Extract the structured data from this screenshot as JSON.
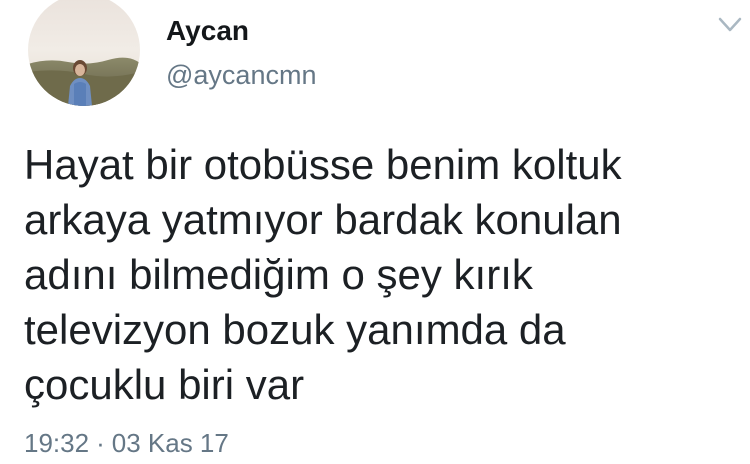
{
  "tweet": {
    "author": {
      "display_name": "Aycan",
      "handle": "@aycancmn"
    },
    "text_lines": [
      "Hayat bir otobüsse benim koltuk",
      "arkaya yatmıyor bardak konulan",
      "adını bilmediğim o şey kırık",
      "televizyon bozuk yanımda da",
      "çocuklu biri var"
    ],
    "time": "19:32",
    "separator": "·",
    "date": "03 Kas 17"
  },
  "icons": {
    "more_options": "chevron-down-icon",
    "avatar": "profile-photo"
  },
  "colors": {
    "name": "#14171a",
    "secondary": "#657786",
    "caret": "#aab8c2"
  }
}
